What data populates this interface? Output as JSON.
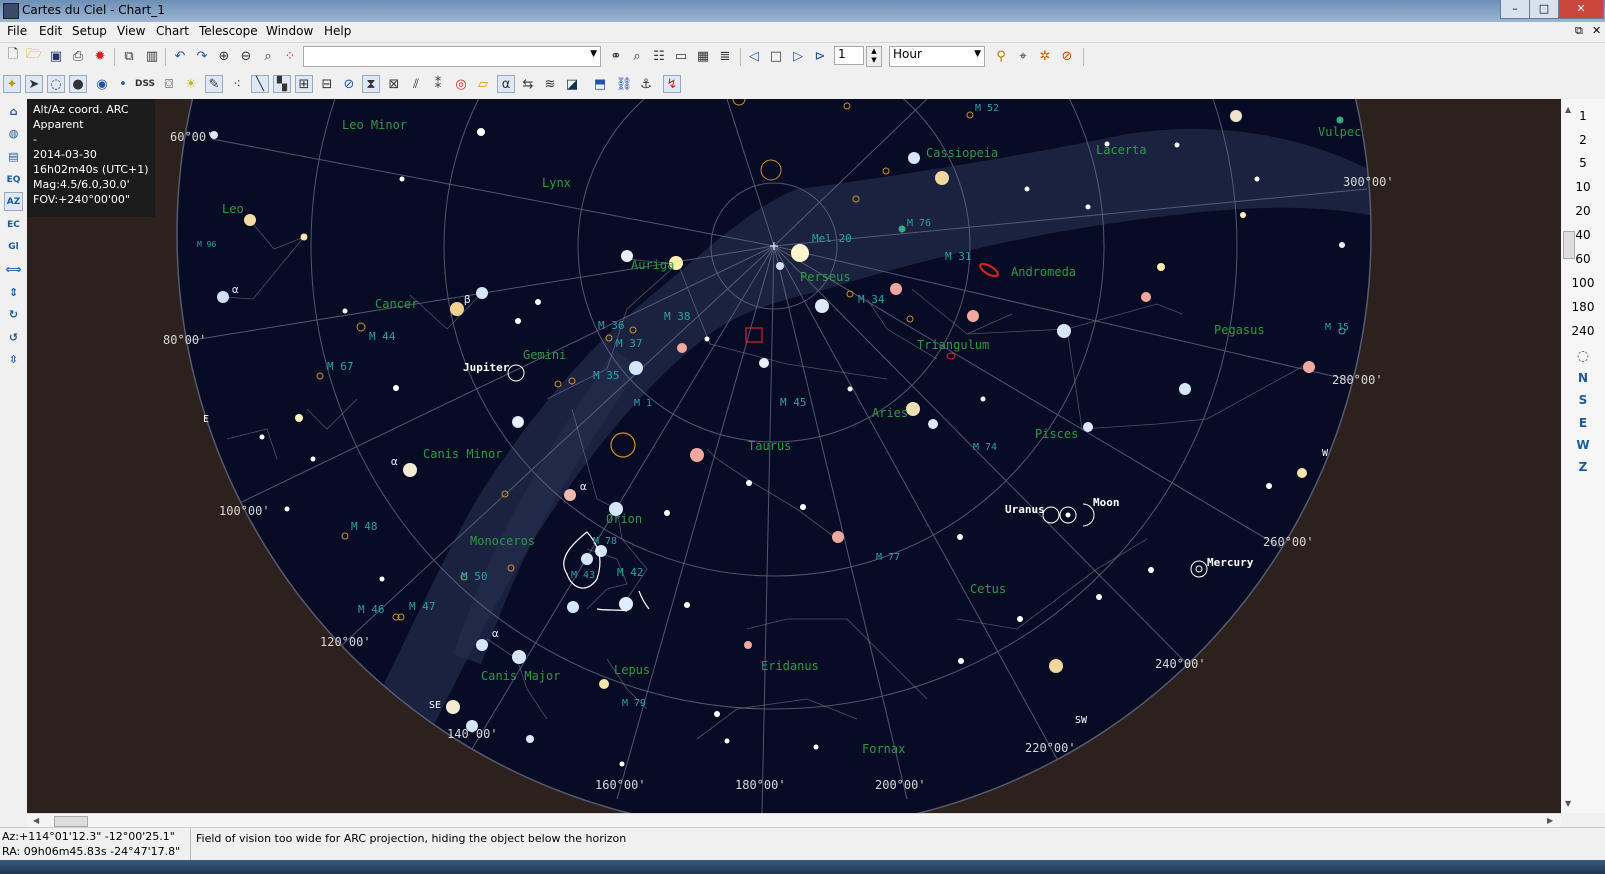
{
  "window": {
    "title": "Cartes du Ciel - Chart_1"
  },
  "menu": [
    "File",
    "Edit",
    "Setup",
    "View",
    "Chart",
    "Telescope",
    "Window",
    "Help"
  ],
  "toolbar": {
    "time_step": "1",
    "time_unit": "Hour",
    "search_value": ""
  },
  "info_panel": {
    "lines": [
      "Alt/Az coord. ARC",
      "Apparent",
      "-",
      "2014-03-30",
      "16h02m40s (UTC+1)",
      "Mag:4.5/6.0,30.0'",
      "FOV:+240°00'00\""
    ]
  },
  "fov_buttons": [
    "1",
    "2",
    "5",
    "10",
    "20",
    "40",
    "60",
    "100",
    "180",
    "240"
  ],
  "direction_buttons": [
    "N",
    "S",
    "E",
    "W",
    "Z"
  ],
  "status": {
    "az": "Az:+114°01'12.3\" -12°00'25.1\"",
    "ra": "RA: 09h06m45.83s -24°47'17.8\"",
    "message": "Field of vision too wide for ARC projection, hiding the object below the horizon"
  },
  "chart": {
    "constellations": [
      "Leo Minor",
      "Lynx",
      "Cassiopeia",
      "Lacerta",
      "Vulpec",
      "Leo",
      "Cancer",
      "Auriga",
      "Perseus",
      "Andromeda",
      "Gemini",
      "Triangulum",
      "Pegasus",
      "Canis Minor",
      "Aries",
      "Taurus",
      "Pisces",
      "Monoceros",
      "Orion",
      "Cetus",
      "Lepus",
      "Canis Major",
      "Eridanus",
      "Fornax"
    ],
    "messier": [
      "M 52",
      "M 76",
      "Mel 20",
      "M 31",
      "M 34",
      "M 44",
      "M 67",
      "M 36",
      "M 38",
      "M 37",
      "M 35",
      "M 1",
      "M 45",
      "M 74",
      "M 48",
      "M 50",
      "M 46",
      "M 47",
      "M 77",
      "M 42",
      "M 78",
      "M 43",
      "M 79",
      "M 15",
      "M 96"
    ],
    "planets": [
      "Jupiter",
      "Uranus",
      "Moon",
      "Mercury"
    ],
    "azimuth_labels": [
      "60°00'",
      "80°00'",
      "100°00'",
      "120°00'",
      "140°00'",
      "160°00'",
      "180°00'",
      "200°00'",
      "220°00'",
      "240°00'",
      "260°00'",
      "280°00'",
      "300°00'"
    ],
    "compass": [
      "E",
      "SE",
      "SW",
      "W"
    ],
    "greek": [
      "α",
      "β",
      "α",
      "α",
      "α"
    ]
  }
}
